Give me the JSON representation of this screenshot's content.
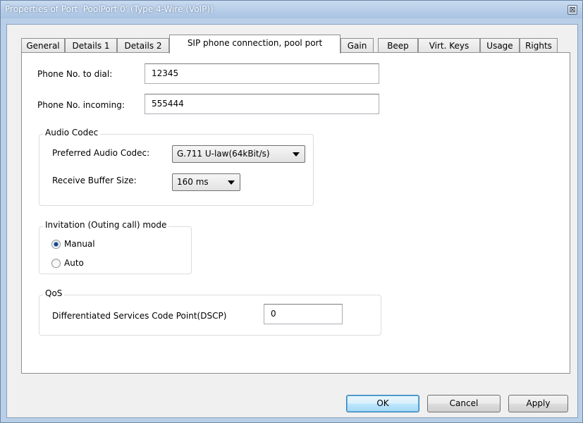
{
  "window": {
    "title": "Properties of Port 'PoolPort 0' (Type 4-Wire (VoIP))",
    "close_glyph": "⊠"
  },
  "tabs": [
    {
      "label": "General",
      "active": false
    },
    {
      "label": "Details 1",
      "active": false
    },
    {
      "label": "Details 2",
      "active": false
    },
    {
      "label": "SIP phone connection, pool port",
      "active": true
    },
    {
      "label": "Gain",
      "active": false
    },
    {
      "label": "Beep",
      "active": false
    },
    {
      "label": "Virt. Keys",
      "active": false
    },
    {
      "label": "Usage",
      "active": false
    },
    {
      "label": "Rights",
      "active": false
    }
  ],
  "form": {
    "phone_dial_label": "Phone No. to dial:",
    "phone_dial_value": "12345",
    "phone_incoming_label": "Phone No. incoming:",
    "phone_incoming_value": "555444"
  },
  "audio_codec": {
    "group_title": "Audio Codec",
    "preferred_label": "Preferred Audio Codec:",
    "preferred_value": "G.711 U-law(64kBit/s)",
    "buffer_label": "Receive Buffer Size:",
    "buffer_value": "160 ms"
  },
  "invitation": {
    "group_title": "Invitation (Outing call) mode",
    "options": [
      {
        "label": "Manual",
        "checked": true
      },
      {
        "label": "Auto",
        "checked": false
      }
    ]
  },
  "qos": {
    "group_title": "QoS",
    "dscp_label": "Differentiated Services Code Point(DSCP)",
    "dscp_value": "0"
  },
  "buttons": {
    "ok": "OK",
    "cancel": "Cancel",
    "apply": "Apply"
  },
  "colors": {
    "frame": "#b9cfe7",
    "dialog_bg": "#f0f0f0",
    "radio_dot": "#1f3f7a"
  }
}
